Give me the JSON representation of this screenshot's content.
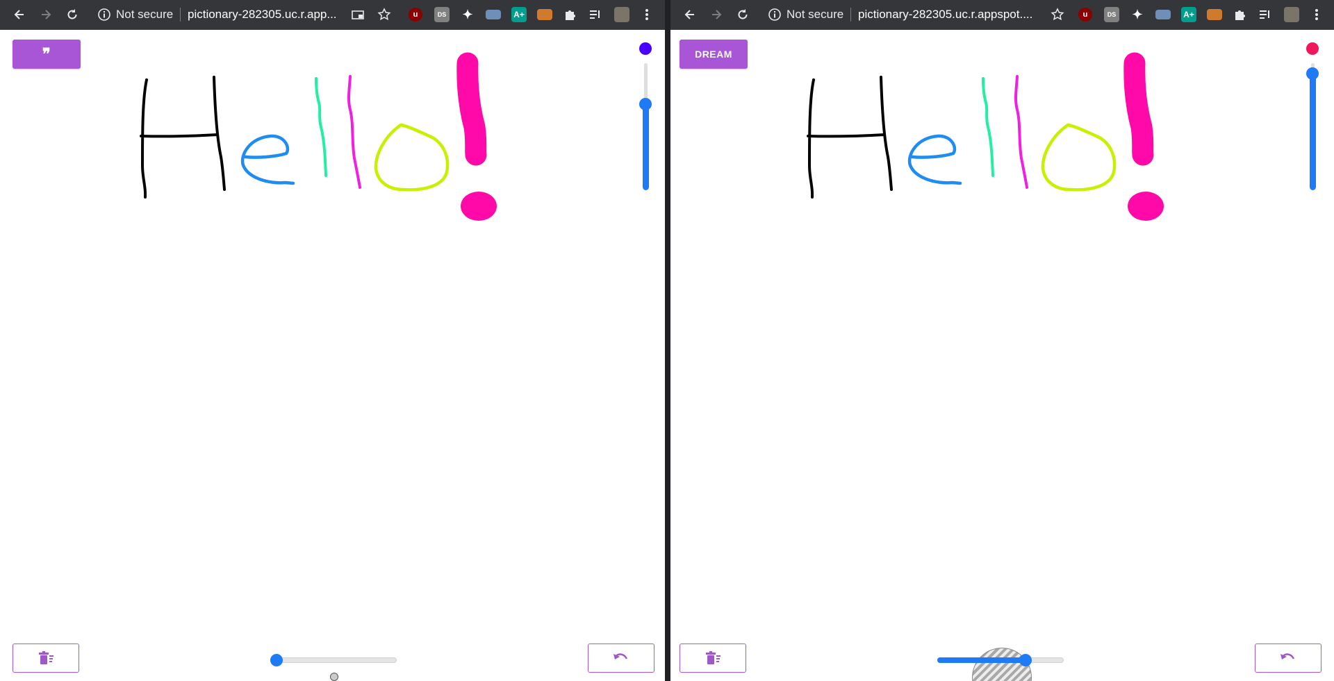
{
  "left_window": {
    "security_label": "Not secure",
    "url": "pictionary-282305.uc.r.app...",
    "top_button": {
      "label": "❞",
      "icon": "quote-icon",
      "color": "#a855d6"
    },
    "color_dot": "#4a00ff",
    "vertical_slider_value": 0.68,
    "horizontal_slider_value": 0.05,
    "clear_button_icon": "delete-sweep-icon",
    "undo_button_icon": "undo-icon"
  },
  "right_window": {
    "security_label": "Not secure",
    "url": "pictionary-282305.uc.r.appspot....",
    "top_button": {
      "label": "DREAM",
      "color": "#a855d6"
    },
    "color_dot": "#f0185a",
    "vertical_slider_value": 0.92,
    "horizontal_slider_value": 0.7,
    "clear_button_icon": "delete-sweep-icon",
    "undo_button_icon": "undo-icon"
  },
  "drawing": {
    "strokes": [
      {
        "letter": "H",
        "color": "#000000"
      },
      {
        "letter": "e",
        "color": "#1e8cf0"
      },
      {
        "letter": "l",
        "color": "#22f0a0"
      },
      {
        "letter": "l",
        "color": "#f020e0"
      },
      {
        "letter": "o",
        "color": "#c8f000"
      },
      {
        "letter": "!",
        "color": "#ff0aa8"
      }
    ]
  },
  "extensions": [
    "ublock-icon",
    "dictionary-icon",
    "bird-icon",
    "tab-icon",
    "grammar-icon",
    "screen-icon",
    "puzzle-icon",
    "playlist-icon",
    "avatar"
  ]
}
